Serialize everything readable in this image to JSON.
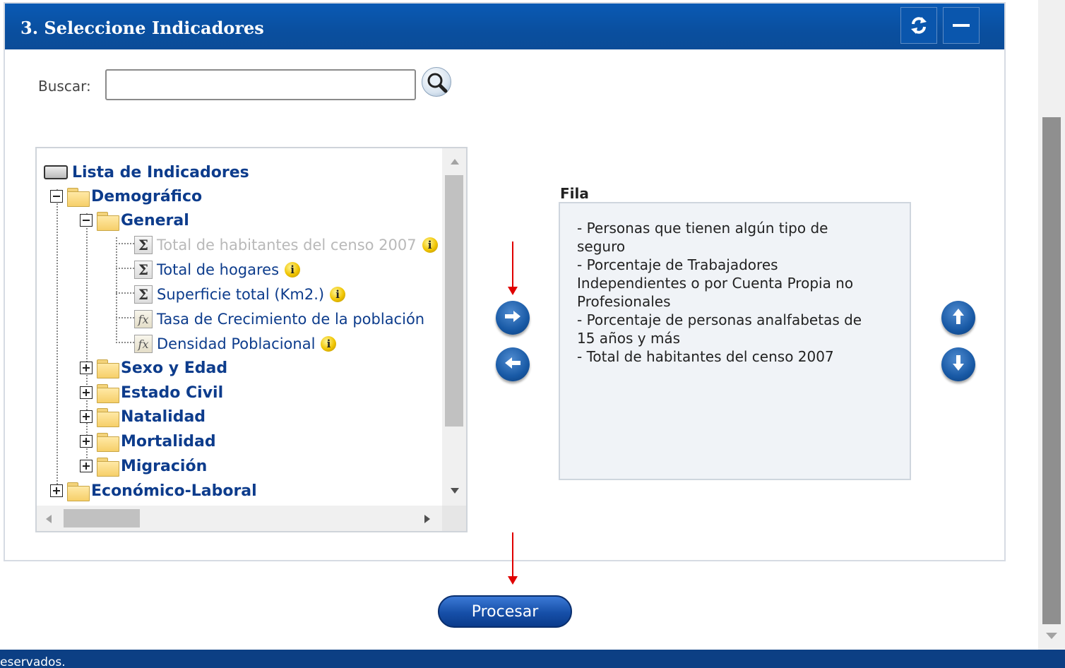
{
  "panel": {
    "title": "3. Seleccione Indicadores",
    "refresh_icon": "refresh-icon",
    "collapse_icon": "minimize-icon"
  },
  "search": {
    "label": "Buscar:",
    "value": "",
    "placeholder": "",
    "icon": "search-icon"
  },
  "tree": {
    "root": "Lista de Indicadores",
    "nodes": {
      "demografico": "Demográfico",
      "general": "General",
      "total_habitantes": "Total de habitantes del censo 2007",
      "total_hogares": "Total de hogares",
      "superficie": "Superficie total (Km2.)",
      "tasa_crecimiento": "Tasa de Crecimiento de la población",
      "densidad": "Densidad Poblacional",
      "sexo_edad": "Sexo y Edad",
      "estado_civil": "Estado Civil",
      "natalidad": "Natalidad",
      "mortalidad": "Mortalidad",
      "migracion": "Migración",
      "economico": "Económico-Laboral"
    },
    "info_glyph": "i",
    "sigma_glyph": "Σ",
    "fx_glyph": "fx"
  },
  "fila": {
    "label": "Fila",
    "items": [
      "- Personas que tienen algún tipo de",
      "seguro",
      "- Porcentaje de Trabajadores",
      "Independientes o por Cuenta Propia no",
      "Profesionales",
      "- Porcentaje de personas analfabetas de",
      "15 años y más",
      "- Total de habitantes del censo 2007"
    ]
  },
  "buttons": {
    "procesar": "Procesar"
  },
  "footer": {
    "text": "eservados."
  },
  "colors": {
    "header_blue": "#0a56ad",
    "tree_text": "#0d3c8c",
    "annotation_red": "#e00000"
  }
}
